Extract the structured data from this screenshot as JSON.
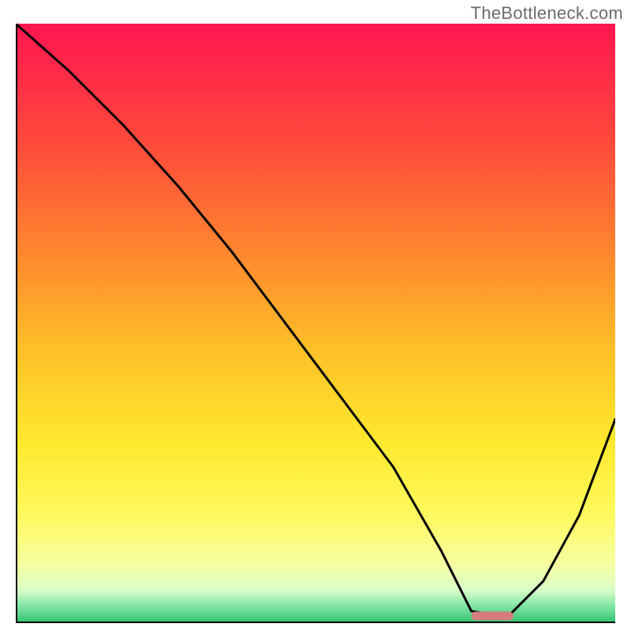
{
  "watermark": "TheBottleneck.com",
  "chart_data": {
    "type": "line",
    "title": "",
    "xlabel": "",
    "ylabel": "",
    "xlim": [
      0,
      100
    ],
    "ylim": [
      0,
      100
    ],
    "grid": false,
    "legend": false,
    "series": [
      {
        "name": "curve",
        "x": [
          0,
          9,
          18,
          27,
          36,
          45,
          54,
          63,
          71,
          76,
          82,
          88,
          94,
          100
        ],
        "y": [
          100,
          92,
          83,
          73,
          62,
          50,
          38,
          26,
          12,
          2,
          1,
          7,
          18,
          34
        ]
      }
    ],
    "marker": {
      "name": "optimum-marker",
      "x_start": 76,
      "x_end": 83,
      "y": 1.2,
      "color": "#d67d7d"
    },
    "background_gradient": {
      "stops": [
        {
          "offset": 0.0,
          "color": "#ff1650"
        },
        {
          "offset": 0.2,
          "color": "#ff4a3b"
        },
        {
          "offset": 0.4,
          "color": "#ff8d2d"
        },
        {
          "offset": 0.55,
          "color": "#ffc228"
        },
        {
          "offset": 0.7,
          "color": "#ffe92e"
        },
        {
          "offset": 0.82,
          "color": "#fff95e"
        },
        {
          "offset": 0.9,
          "color": "#f6ffa0"
        },
        {
          "offset": 0.945,
          "color": "#d9ffc8"
        },
        {
          "offset": 0.97,
          "color": "#86e6a8"
        },
        {
          "offset": 1.0,
          "color": "#2fc46f"
        }
      ]
    },
    "axis_color": "#000000",
    "curve_color": "#000000",
    "curve_width": 3
  }
}
